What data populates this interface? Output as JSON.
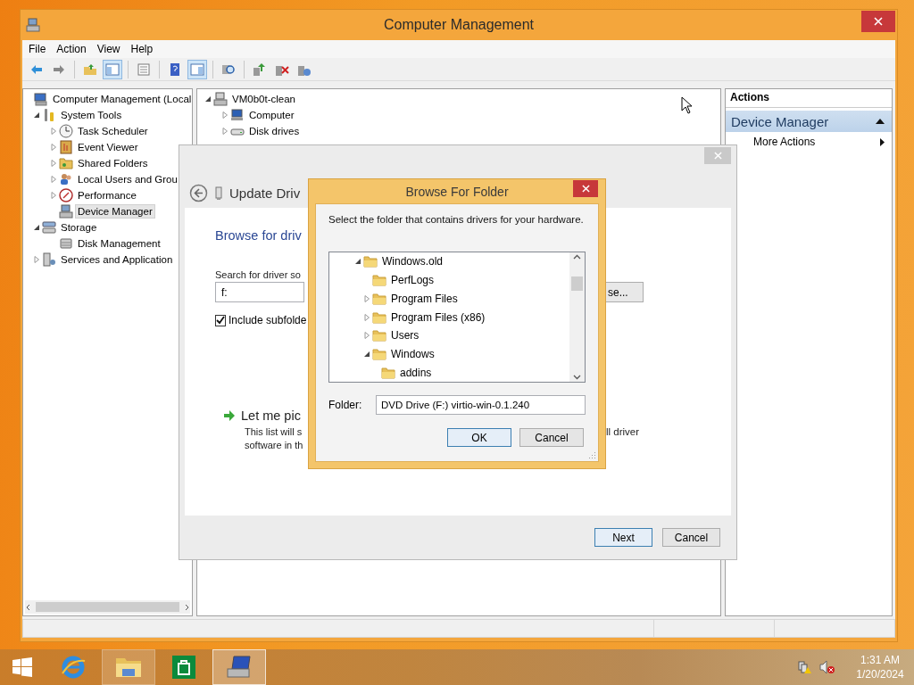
{
  "main_window": {
    "title": "Computer Management",
    "menu": [
      "File",
      "Action",
      "View",
      "Help"
    ],
    "toolbar": [
      {
        "kind": "button",
        "pressed": false
      },
      {
        "kind": "button",
        "pressed": false
      },
      {
        "kind": "separator"
      },
      {
        "kind": "button",
        "pressed": false
      },
      {
        "kind": "button",
        "pressed": true
      },
      {
        "kind": "separator"
      },
      {
        "kind": "button",
        "pressed": false
      },
      {
        "kind": "separator"
      },
      {
        "kind": "button",
        "pressed": false
      },
      {
        "kind": "button",
        "pressed": true
      },
      {
        "kind": "separator"
      },
      {
        "kind": "button",
        "pressed": false
      },
      {
        "kind": "separator"
      },
      {
        "kind": "button",
        "pressed": false
      },
      {
        "kind": "button",
        "pressed": false
      },
      {
        "kind": "button",
        "pressed": false
      }
    ],
    "console_tree": [
      {
        "label": "Computer Management (Local",
        "selected": false,
        "children": [
          {
            "label": "System Tools",
            "selected": false,
            "expanded": true,
            "children": [
              {
                "label": "Task Scheduler",
                "selected": false,
                "expanded": false
              },
              {
                "label": "Event Viewer",
                "selected": false,
                "expanded": false
              },
              {
                "label": "Shared Folders",
                "selected": false,
                "expanded": false
              },
              {
                "label": "Local Users and Grou",
                "selected": false,
                "expanded": false
              },
              {
                "label": "Performance",
                "selected": false,
                "expanded": false
              },
              {
                "label": "Device Manager",
                "selected": true
              }
            ]
          },
          {
            "label": "Storage",
            "selected": false,
            "expanded": true,
            "children": [
              {
                "label": "Disk Management",
                "selected": false
              }
            ]
          },
          {
            "label": "Services and Application",
            "selected": false,
            "expanded": false
          }
        ]
      }
    ],
    "device_tree": [
      {
        "label": "VM0b0t-clean",
        "selected": false,
        "expanded": true,
        "children": [
          {
            "label": "Computer",
            "selected": false,
            "expanded": false
          },
          {
            "label": "Disk drives",
            "selected": false,
            "expanded": false
          }
        ]
      }
    ],
    "actions": {
      "title": "Actions",
      "section": "Device Manager",
      "expanded": true,
      "items": [
        "More Actions"
      ]
    }
  },
  "update_driver_dialog": {
    "title": "Update Driv",
    "heading": "Browse for driv",
    "search_label": "Search for driver so",
    "path": "f:",
    "browse_button": "se...",
    "include_subfolders": {
      "label": "Include subfolde",
      "checked": true
    },
    "pick_option": {
      "title": "Let me pic",
      "line_1": "This list will s",
      "line_1_end": "ll driver",
      "line_2": "software in th"
    },
    "buttons": [
      {
        "label": "Next",
        "default": true
      },
      {
        "label": "Cancel",
        "default": false
      }
    ]
  },
  "browse_dialog": {
    "title": "Browse For Folder",
    "prompt": "Select the folder that contains drivers for your hardware.",
    "tree": [
      {
        "label": "Windows.old",
        "selected": false,
        "expanded": true,
        "children": [
          {
            "label": "PerfLogs",
            "selected": false
          },
          {
            "label": "Program Files",
            "selected": false,
            "expanded": false
          },
          {
            "label": "Program Files (x86)",
            "selected": false,
            "expanded": false
          },
          {
            "label": "Users",
            "selected": false,
            "expanded": false
          },
          {
            "label": "Windows",
            "selected": false,
            "expanded": true,
            "children": [
              {
                "label": "addins",
                "selected": false
              }
            ]
          }
        ]
      }
    ],
    "folder_label": "Folder:",
    "folder": "DVD Drive (F:) virtio-win-0.1.240",
    "buttons": [
      {
        "label": "OK",
        "default": true
      },
      {
        "label": "Cancel",
        "default": false
      }
    ]
  },
  "taskbar": {
    "apps": [
      {
        "running": false,
        "selected": false
      },
      {
        "running": true,
        "selected": false
      },
      {
        "running": false,
        "selected": false
      },
      {
        "running": true,
        "selected": true
      }
    ],
    "clock": {
      "time": "1:31 AM",
      "date": "1/20/2024"
    }
  }
}
